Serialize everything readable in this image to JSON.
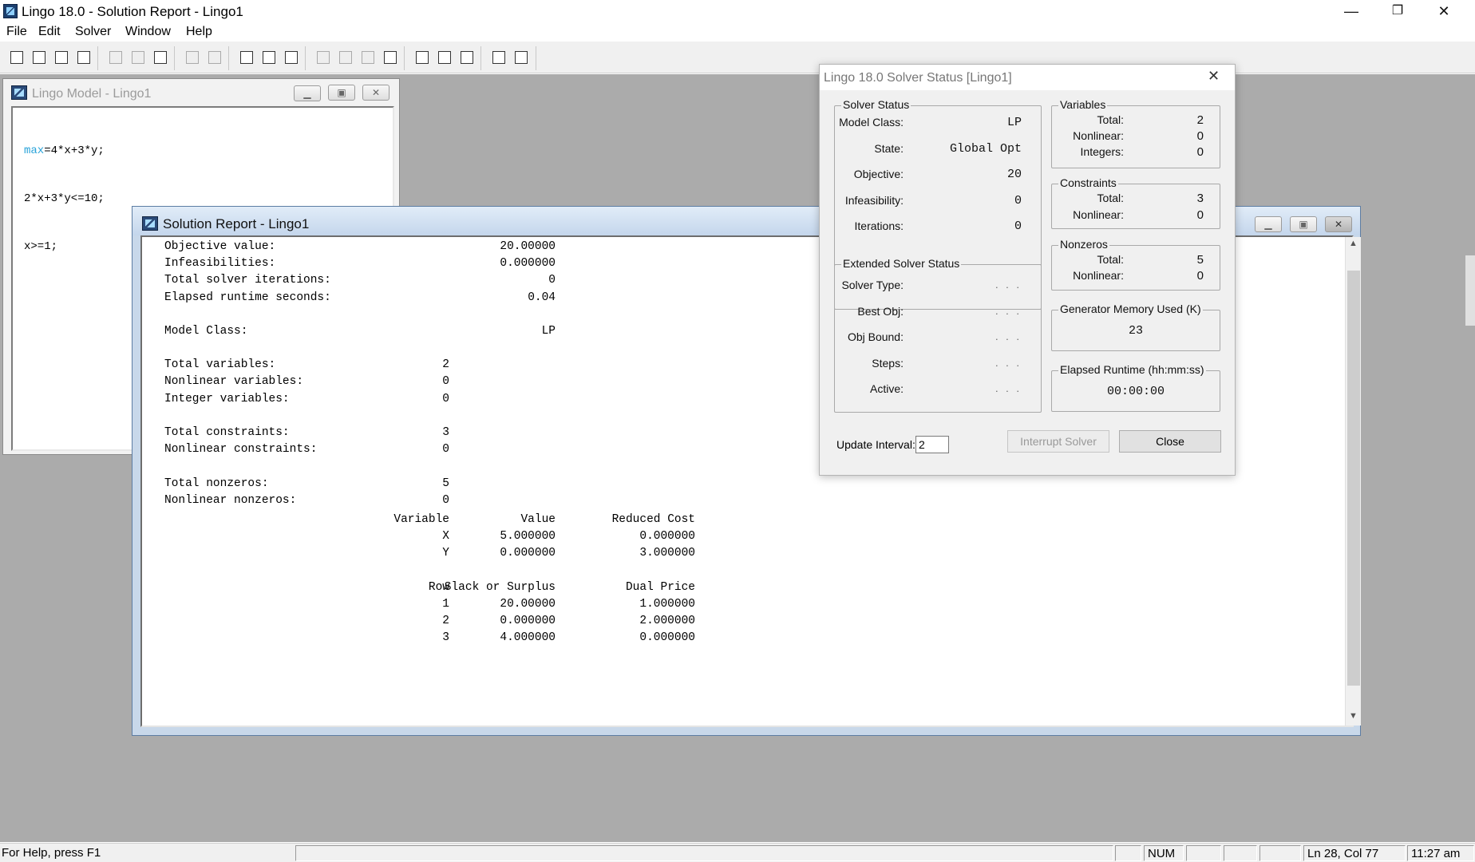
{
  "app": {
    "title": "Lingo 18.0 - Solution Report - Lingo1",
    "minimize": "—",
    "restore": "❐",
    "close": "✕"
  },
  "menu": [
    "File",
    "Edit",
    "Solver",
    "Window",
    "Help"
  ],
  "toolbar": {
    "icons": [
      "new-icon",
      "open-icon",
      "save-icon",
      "print-icon",
      "cut-icon",
      "copy-icon",
      "paste-icon",
      "undo-icon",
      "redo-icon",
      "find-icon",
      "find-next-icon",
      "goto-icon",
      "solve-icon",
      "interrupt-icon",
      "compile-icon",
      "close-all-icon",
      "tile-icon",
      "cascade-icon",
      "layout-icon",
      "help-icon",
      "context-help-icon"
    ]
  },
  "model_window": {
    "title": "Lingo Model - Lingo1",
    "code": [
      {
        "kw": "max",
        "rest": "=4*x+3*y;"
      },
      {
        "kw": "",
        "rest": "2*x+3*y<=10;"
      },
      {
        "kw": "",
        "rest": "x>=1;"
      }
    ],
    "keyword_color": "#29a3d9"
  },
  "solution_window": {
    "title": "Solution Report - Lingo1",
    "summary": [
      {
        "label": "Objective value:",
        "value": "20.00000"
      },
      {
        "label": "Infeasibilities:",
        "value": "0.000000"
      },
      {
        "label": "Total solver iterations:",
        "value": "0"
      },
      {
        "label": "Elapsed runtime seconds:",
        "value": "0.04"
      }
    ],
    "model_class": {
      "label": "Model Class:",
      "value": "LP"
    },
    "variables_counts": [
      {
        "label": "Total variables:",
        "value": "2"
      },
      {
        "label": "Nonlinear variables:",
        "value": "0"
      },
      {
        "label": "Integer variables:",
        "value": "0"
      }
    ],
    "constraint_counts": [
      {
        "label": "Total constraints:",
        "value": "3"
      },
      {
        "label": "Nonlinear constraints:",
        "value": "0"
      }
    ],
    "nonzero_counts": [
      {
        "label": "Total nonzeros:",
        "value": "5"
      },
      {
        "label": "Nonlinear nonzeros:",
        "value": "0"
      }
    ],
    "var_table": {
      "headers": [
        "Variable",
        "Value",
        "Reduced Cost"
      ],
      "rows": [
        [
          "X",
          "5.000000",
          "0.000000"
        ],
        [
          "Y",
          "0.000000",
          "3.000000"
        ]
      ]
    },
    "row_table": {
      "headers": [
        "Row",
        "Slack or Surplus",
        "Dual Price"
      ],
      "rows": [
        [
          "1",
          "20.00000",
          "1.000000"
        ],
        [
          "2",
          "0.000000",
          "2.000000"
        ],
        [
          "3",
          "4.000000",
          "0.000000"
        ]
      ]
    }
  },
  "solver_status": {
    "title": "Lingo 18.0 Solver Status [Lingo1]",
    "close_glyph": "✕",
    "solver_status_group": "Solver Status",
    "fields": [
      {
        "label": "Model Class:",
        "value": "LP"
      },
      {
        "label": "State:",
        "value": "Global Opt"
      },
      {
        "label": "Objective:",
        "value": "20"
      },
      {
        "label": "Infeasibility:",
        "value": "0"
      },
      {
        "label": "Iterations:",
        "value": "0"
      }
    ],
    "extended_group": "Extended Solver Status",
    "extended_fields": [
      {
        "label": "Solver Type:",
        "value": ". . ."
      },
      {
        "label": "Best Obj:",
        "value": ". . ."
      },
      {
        "label": "Obj Bound:",
        "value": ". . ."
      },
      {
        "label": "Steps:",
        "value": ". . ."
      },
      {
        "label": "Active:",
        "value": ". . ."
      }
    ],
    "variables_group": "Variables",
    "variables": [
      {
        "label": "Total:",
        "value": "2"
      },
      {
        "label": "Nonlinear:",
        "value": "0"
      },
      {
        "label": "Integers:",
        "value": "0"
      }
    ],
    "constraints_group": "Constraints",
    "constraints": [
      {
        "label": "Total:",
        "value": "3"
      },
      {
        "label": "Nonlinear:",
        "value": "0"
      }
    ],
    "nonzeros_group": "Nonzeros",
    "nonzeros": [
      {
        "label": "Total:",
        "value": "5"
      },
      {
        "label": "Nonlinear:",
        "value": "0"
      }
    ],
    "memory_group": "Generator Memory Used (K)",
    "memory_value": "23",
    "runtime_group": "Elapsed Runtime (hh:mm:ss)",
    "runtime_value": "00:00:00",
    "update_interval_label": "Update Interval:",
    "update_interval_value": "2",
    "interrupt_button": "Interrupt Solver",
    "close_button": "Close"
  },
  "status_bar": {
    "help": "For Help, press F1",
    "num": "NUM",
    "position": "Ln 28, Col 77",
    "time": "11:27 am"
  }
}
